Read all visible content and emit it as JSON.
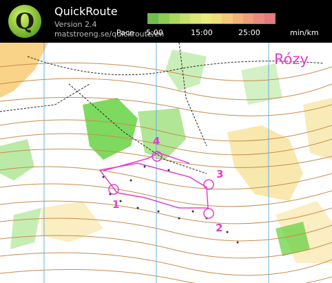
{
  "header": {
    "logo_letter": "Q",
    "app_name": "QuickRoute",
    "version": "Version 2.4",
    "url": "matstroeng.se/quickroute/en"
  },
  "pace_legend": {
    "label": "Pace",
    "ticks": [
      "5:00",
      "15:00",
      "25:00"
    ],
    "unit": "min/km",
    "colors": [
      "#6fbf4a",
      "#8ccc55",
      "#a9d860",
      "#c4e26b",
      "#dbe876",
      "#ecea7e",
      "#f3dc7c",
      "#f3c97a",
      "#f1b37a",
      "#ee9e7a",
      "#ea8b7c",
      "#e67a7e"
    ]
  },
  "map": {
    "place_name": "Rózy",
    "controls": [
      "1",
      "2",
      "3",
      "4"
    ],
    "route_color": "#e040c8",
    "contour_color": "#c98a4a",
    "vegetation_color": "#5ecf3a",
    "magnetic_line_color": "#6ab0d8"
  }
}
